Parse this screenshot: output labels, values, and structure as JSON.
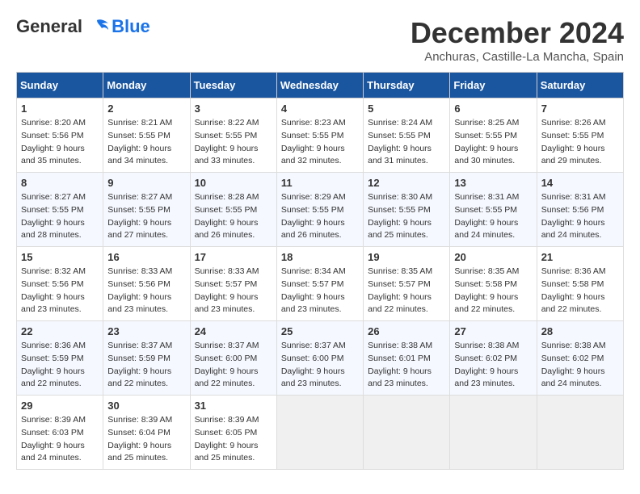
{
  "header": {
    "logo_line1": "General",
    "logo_line2": "Blue",
    "month": "December 2024",
    "location": "Anchuras, Castille-La Mancha, Spain"
  },
  "weekdays": [
    "Sunday",
    "Monday",
    "Tuesday",
    "Wednesday",
    "Thursday",
    "Friday",
    "Saturday"
  ],
  "weeks": [
    [
      {
        "day": "1",
        "sunrise": "8:20 AM",
        "sunset": "5:56 PM",
        "daylight": "9 hours and 35 minutes."
      },
      {
        "day": "2",
        "sunrise": "8:21 AM",
        "sunset": "5:55 PM",
        "daylight": "9 hours and 34 minutes."
      },
      {
        "day": "3",
        "sunrise": "8:22 AM",
        "sunset": "5:55 PM",
        "daylight": "9 hours and 33 minutes."
      },
      {
        "day": "4",
        "sunrise": "8:23 AM",
        "sunset": "5:55 PM",
        "daylight": "9 hours and 32 minutes."
      },
      {
        "day": "5",
        "sunrise": "8:24 AM",
        "sunset": "5:55 PM",
        "daylight": "9 hours and 31 minutes."
      },
      {
        "day": "6",
        "sunrise": "8:25 AM",
        "sunset": "5:55 PM",
        "daylight": "9 hours and 30 minutes."
      },
      {
        "day": "7",
        "sunrise": "8:26 AM",
        "sunset": "5:55 PM",
        "daylight": "9 hours and 29 minutes."
      }
    ],
    [
      {
        "day": "8",
        "sunrise": "8:27 AM",
        "sunset": "5:55 PM",
        "daylight": "9 hours and 28 minutes."
      },
      {
        "day": "9",
        "sunrise": "8:27 AM",
        "sunset": "5:55 PM",
        "daylight": "9 hours and 27 minutes."
      },
      {
        "day": "10",
        "sunrise": "8:28 AM",
        "sunset": "5:55 PM",
        "daylight": "9 hours and 26 minutes."
      },
      {
        "day": "11",
        "sunrise": "8:29 AM",
        "sunset": "5:55 PM",
        "daylight": "9 hours and 26 minutes."
      },
      {
        "day": "12",
        "sunrise": "8:30 AM",
        "sunset": "5:55 PM",
        "daylight": "9 hours and 25 minutes."
      },
      {
        "day": "13",
        "sunrise": "8:31 AM",
        "sunset": "5:55 PM",
        "daylight": "9 hours and 24 minutes."
      },
      {
        "day": "14",
        "sunrise": "8:31 AM",
        "sunset": "5:56 PM",
        "daylight": "9 hours and 24 minutes."
      }
    ],
    [
      {
        "day": "15",
        "sunrise": "8:32 AM",
        "sunset": "5:56 PM",
        "daylight": "9 hours and 23 minutes."
      },
      {
        "day": "16",
        "sunrise": "8:33 AM",
        "sunset": "5:56 PM",
        "daylight": "9 hours and 23 minutes."
      },
      {
        "day": "17",
        "sunrise": "8:33 AM",
        "sunset": "5:57 PM",
        "daylight": "9 hours and 23 minutes."
      },
      {
        "day": "18",
        "sunrise": "8:34 AM",
        "sunset": "5:57 PM",
        "daylight": "9 hours and 23 minutes."
      },
      {
        "day": "19",
        "sunrise": "8:35 AM",
        "sunset": "5:57 PM",
        "daylight": "9 hours and 22 minutes."
      },
      {
        "day": "20",
        "sunrise": "8:35 AM",
        "sunset": "5:58 PM",
        "daylight": "9 hours and 22 minutes."
      },
      {
        "day": "21",
        "sunrise": "8:36 AM",
        "sunset": "5:58 PM",
        "daylight": "9 hours and 22 minutes."
      }
    ],
    [
      {
        "day": "22",
        "sunrise": "8:36 AM",
        "sunset": "5:59 PM",
        "daylight": "9 hours and 22 minutes."
      },
      {
        "day": "23",
        "sunrise": "8:37 AM",
        "sunset": "5:59 PM",
        "daylight": "9 hours and 22 minutes."
      },
      {
        "day": "24",
        "sunrise": "8:37 AM",
        "sunset": "6:00 PM",
        "daylight": "9 hours and 22 minutes."
      },
      {
        "day": "25",
        "sunrise": "8:37 AM",
        "sunset": "6:00 PM",
        "daylight": "9 hours and 23 minutes."
      },
      {
        "day": "26",
        "sunrise": "8:38 AM",
        "sunset": "6:01 PM",
        "daylight": "9 hours and 23 minutes."
      },
      {
        "day": "27",
        "sunrise": "8:38 AM",
        "sunset": "6:02 PM",
        "daylight": "9 hours and 23 minutes."
      },
      {
        "day": "28",
        "sunrise": "8:38 AM",
        "sunset": "6:02 PM",
        "daylight": "9 hours and 24 minutes."
      }
    ],
    [
      {
        "day": "29",
        "sunrise": "8:39 AM",
        "sunset": "6:03 PM",
        "daylight": "9 hours and 24 minutes."
      },
      {
        "day": "30",
        "sunrise": "8:39 AM",
        "sunset": "6:04 PM",
        "daylight": "9 hours and 25 minutes."
      },
      {
        "day": "31",
        "sunrise": "8:39 AM",
        "sunset": "6:05 PM",
        "daylight": "9 hours and 25 minutes."
      },
      null,
      null,
      null,
      null
    ]
  ]
}
